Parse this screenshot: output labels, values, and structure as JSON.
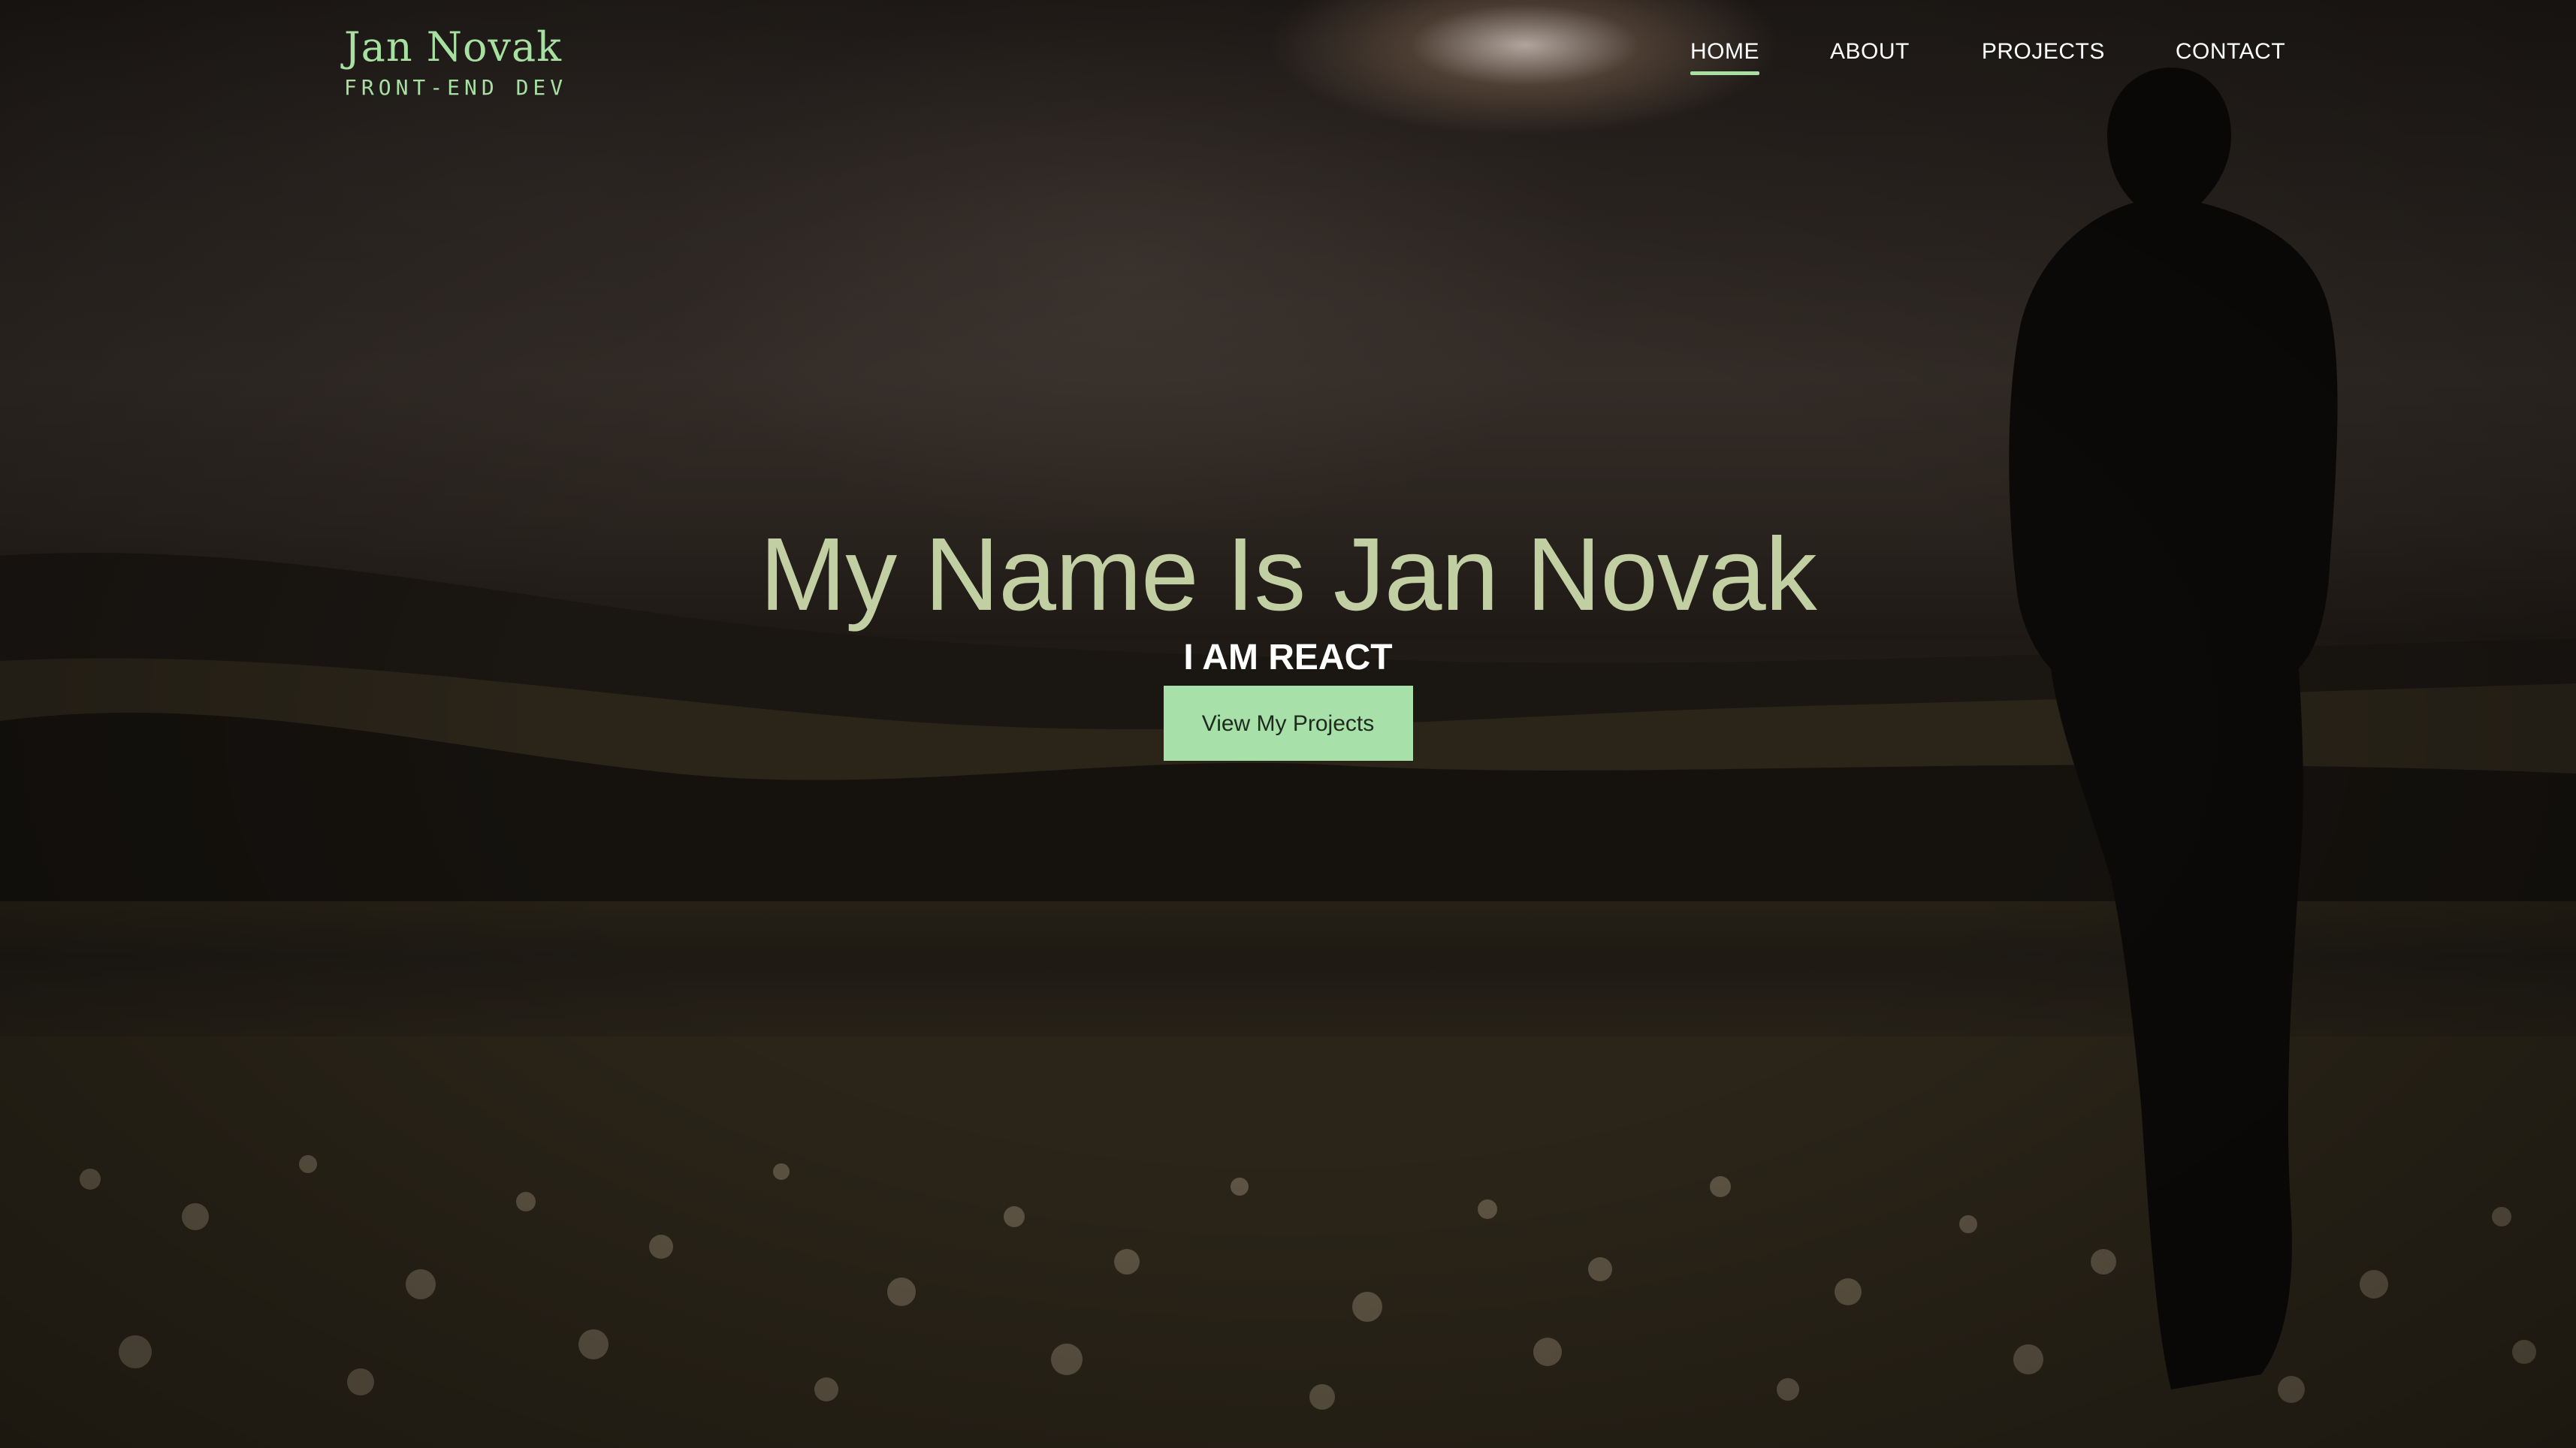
{
  "header": {
    "logo_name": "Jan Novak",
    "logo_sub": "FRONT-END DEV",
    "nav": [
      {
        "label": "HOME",
        "active": true
      },
      {
        "label": "ABOUT",
        "active": false
      },
      {
        "label": "PROJECTS",
        "active": false
      },
      {
        "label": "CONTACT",
        "active": false
      }
    ]
  },
  "hero": {
    "title": "My Name Is Jan Novak",
    "subtitle": "I AM REACT",
    "button_label": "View My Projects"
  },
  "colors": {
    "accent": "#a7e0a0",
    "title": "#c2cfa3",
    "nav_text": "#ffffff",
    "button_bg": "#a7e0a8"
  }
}
